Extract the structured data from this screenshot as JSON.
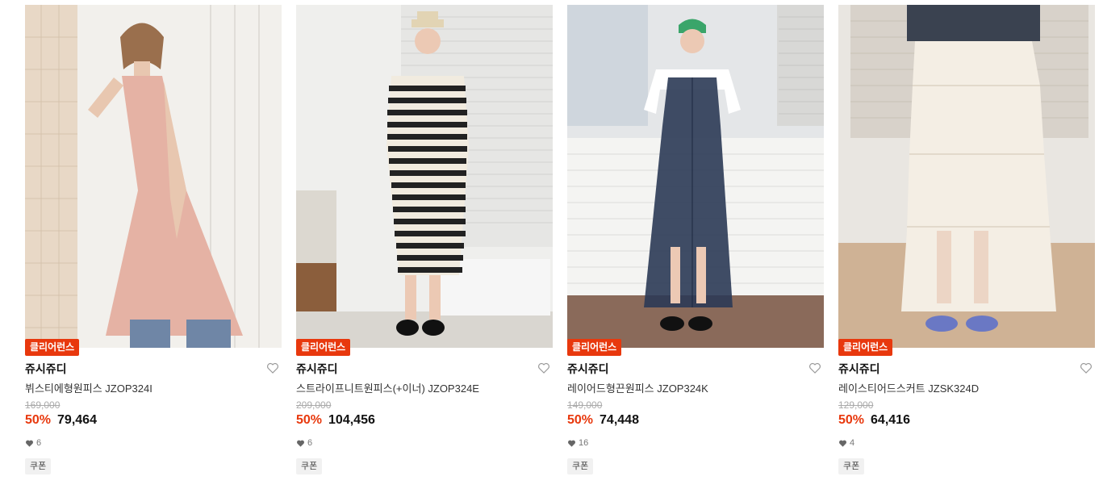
{
  "products": [
    {
      "badge": "클리어런스",
      "brand": "쥬시쥬디",
      "name": "뷔스티에형원피스 JZOP324I",
      "original_price": "169,000",
      "discount": "50%",
      "price": "79,464",
      "likes": "6",
      "coupon": "쿠폰",
      "photo": "model-pink-bustier-dress"
    },
    {
      "badge": "클리어런스",
      "brand": "쥬시쥬디",
      "name": "스트라이프니트원피스(+이너) JZOP324E",
      "original_price": "209,000",
      "discount": "50%",
      "price": "104,456",
      "likes": "6",
      "coupon": "쿠폰",
      "photo": "model-striped-knit-dress"
    },
    {
      "badge": "클리어런스",
      "brand": "쥬시쥬디",
      "name": "레이어드형끈원피스 JZOP324K",
      "original_price": "149,000",
      "discount": "50%",
      "price": "74,448",
      "likes": "16",
      "coupon": "쿠폰",
      "photo": "model-navy-sheer-dress"
    },
    {
      "badge": "클리어런스",
      "brand": "쥬시쥬디",
      "name": "레이스티어드스커트 JZSK324D",
      "original_price": "129,000",
      "discount": "50%",
      "price": "64,416",
      "likes": "4",
      "coupon": "쿠폰",
      "photo": "model-white-lace-skirt"
    }
  ],
  "colors": {
    "badge_bg": "#e8380d",
    "discount": "#e8380d"
  }
}
